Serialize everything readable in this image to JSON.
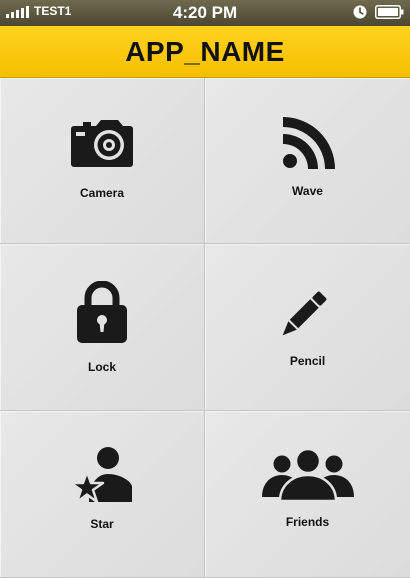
{
  "status_bar": {
    "carrier": "TEST1",
    "time": "4:20 PM",
    "icons": [
      "signal-icon",
      "alarm-icon",
      "battery-icon"
    ]
  },
  "header": {
    "title": "APP_NAME",
    "background": "#FFCC00"
  },
  "tiles": [
    {
      "label": "Camera",
      "icon": "camera-icon"
    },
    {
      "label": "Wave",
      "icon": "wave-icon"
    },
    {
      "label": "Lock",
      "icon": "lock-icon"
    },
    {
      "label": "Pencil",
      "icon": "pencil-icon"
    },
    {
      "label": "Star",
      "icon": "user-star-icon"
    },
    {
      "label": "Friends",
      "icon": "friends-icon"
    }
  ],
  "colors": {
    "accent": "#FFCC00",
    "icon": "#1a1a1a",
    "tile_background": "#E2E2E2"
  }
}
